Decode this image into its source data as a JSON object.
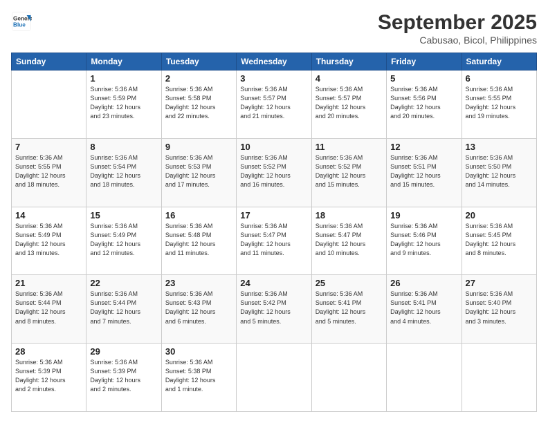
{
  "logo": {
    "line1": "General",
    "line2": "Blue"
  },
  "title": "September 2025",
  "subtitle": "Cabusao, Bicol, Philippines",
  "weekdays": [
    "Sunday",
    "Monday",
    "Tuesday",
    "Wednesday",
    "Thursday",
    "Friday",
    "Saturday"
  ],
  "weeks": [
    [
      {
        "day": "",
        "info": ""
      },
      {
        "day": "1",
        "info": "Sunrise: 5:36 AM\nSunset: 5:59 PM\nDaylight: 12 hours\nand 23 minutes."
      },
      {
        "day": "2",
        "info": "Sunrise: 5:36 AM\nSunset: 5:58 PM\nDaylight: 12 hours\nand 22 minutes."
      },
      {
        "day": "3",
        "info": "Sunrise: 5:36 AM\nSunset: 5:57 PM\nDaylight: 12 hours\nand 21 minutes."
      },
      {
        "day": "4",
        "info": "Sunrise: 5:36 AM\nSunset: 5:57 PM\nDaylight: 12 hours\nand 20 minutes."
      },
      {
        "day": "5",
        "info": "Sunrise: 5:36 AM\nSunset: 5:56 PM\nDaylight: 12 hours\nand 20 minutes."
      },
      {
        "day": "6",
        "info": "Sunrise: 5:36 AM\nSunset: 5:55 PM\nDaylight: 12 hours\nand 19 minutes."
      }
    ],
    [
      {
        "day": "7",
        "info": "Sunrise: 5:36 AM\nSunset: 5:55 PM\nDaylight: 12 hours\nand 18 minutes."
      },
      {
        "day": "8",
        "info": "Sunrise: 5:36 AM\nSunset: 5:54 PM\nDaylight: 12 hours\nand 18 minutes."
      },
      {
        "day": "9",
        "info": "Sunrise: 5:36 AM\nSunset: 5:53 PM\nDaylight: 12 hours\nand 17 minutes."
      },
      {
        "day": "10",
        "info": "Sunrise: 5:36 AM\nSunset: 5:52 PM\nDaylight: 12 hours\nand 16 minutes."
      },
      {
        "day": "11",
        "info": "Sunrise: 5:36 AM\nSunset: 5:52 PM\nDaylight: 12 hours\nand 15 minutes."
      },
      {
        "day": "12",
        "info": "Sunrise: 5:36 AM\nSunset: 5:51 PM\nDaylight: 12 hours\nand 15 minutes."
      },
      {
        "day": "13",
        "info": "Sunrise: 5:36 AM\nSunset: 5:50 PM\nDaylight: 12 hours\nand 14 minutes."
      }
    ],
    [
      {
        "day": "14",
        "info": "Sunrise: 5:36 AM\nSunset: 5:49 PM\nDaylight: 12 hours\nand 13 minutes."
      },
      {
        "day": "15",
        "info": "Sunrise: 5:36 AM\nSunset: 5:49 PM\nDaylight: 12 hours\nand 12 minutes."
      },
      {
        "day": "16",
        "info": "Sunrise: 5:36 AM\nSunset: 5:48 PM\nDaylight: 12 hours\nand 11 minutes."
      },
      {
        "day": "17",
        "info": "Sunrise: 5:36 AM\nSunset: 5:47 PM\nDaylight: 12 hours\nand 11 minutes."
      },
      {
        "day": "18",
        "info": "Sunrise: 5:36 AM\nSunset: 5:47 PM\nDaylight: 12 hours\nand 10 minutes."
      },
      {
        "day": "19",
        "info": "Sunrise: 5:36 AM\nSunset: 5:46 PM\nDaylight: 12 hours\nand 9 minutes."
      },
      {
        "day": "20",
        "info": "Sunrise: 5:36 AM\nSunset: 5:45 PM\nDaylight: 12 hours\nand 8 minutes."
      }
    ],
    [
      {
        "day": "21",
        "info": "Sunrise: 5:36 AM\nSunset: 5:44 PM\nDaylight: 12 hours\nand 8 minutes."
      },
      {
        "day": "22",
        "info": "Sunrise: 5:36 AM\nSunset: 5:44 PM\nDaylight: 12 hours\nand 7 minutes."
      },
      {
        "day": "23",
        "info": "Sunrise: 5:36 AM\nSunset: 5:43 PM\nDaylight: 12 hours\nand 6 minutes."
      },
      {
        "day": "24",
        "info": "Sunrise: 5:36 AM\nSunset: 5:42 PM\nDaylight: 12 hours\nand 5 minutes."
      },
      {
        "day": "25",
        "info": "Sunrise: 5:36 AM\nSunset: 5:41 PM\nDaylight: 12 hours\nand 5 minutes."
      },
      {
        "day": "26",
        "info": "Sunrise: 5:36 AM\nSunset: 5:41 PM\nDaylight: 12 hours\nand 4 minutes."
      },
      {
        "day": "27",
        "info": "Sunrise: 5:36 AM\nSunset: 5:40 PM\nDaylight: 12 hours\nand 3 minutes."
      }
    ],
    [
      {
        "day": "28",
        "info": "Sunrise: 5:36 AM\nSunset: 5:39 PM\nDaylight: 12 hours\nand 2 minutes."
      },
      {
        "day": "29",
        "info": "Sunrise: 5:36 AM\nSunset: 5:39 PM\nDaylight: 12 hours\nand 2 minutes."
      },
      {
        "day": "30",
        "info": "Sunrise: 5:36 AM\nSunset: 5:38 PM\nDaylight: 12 hours\nand 1 minute."
      },
      {
        "day": "",
        "info": ""
      },
      {
        "day": "",
        "info": ""
      },
      {
        "day": "",
        "info": ""
      },
      {
        "day": "",
        "info": ""
      }
    ]
  ]
}
